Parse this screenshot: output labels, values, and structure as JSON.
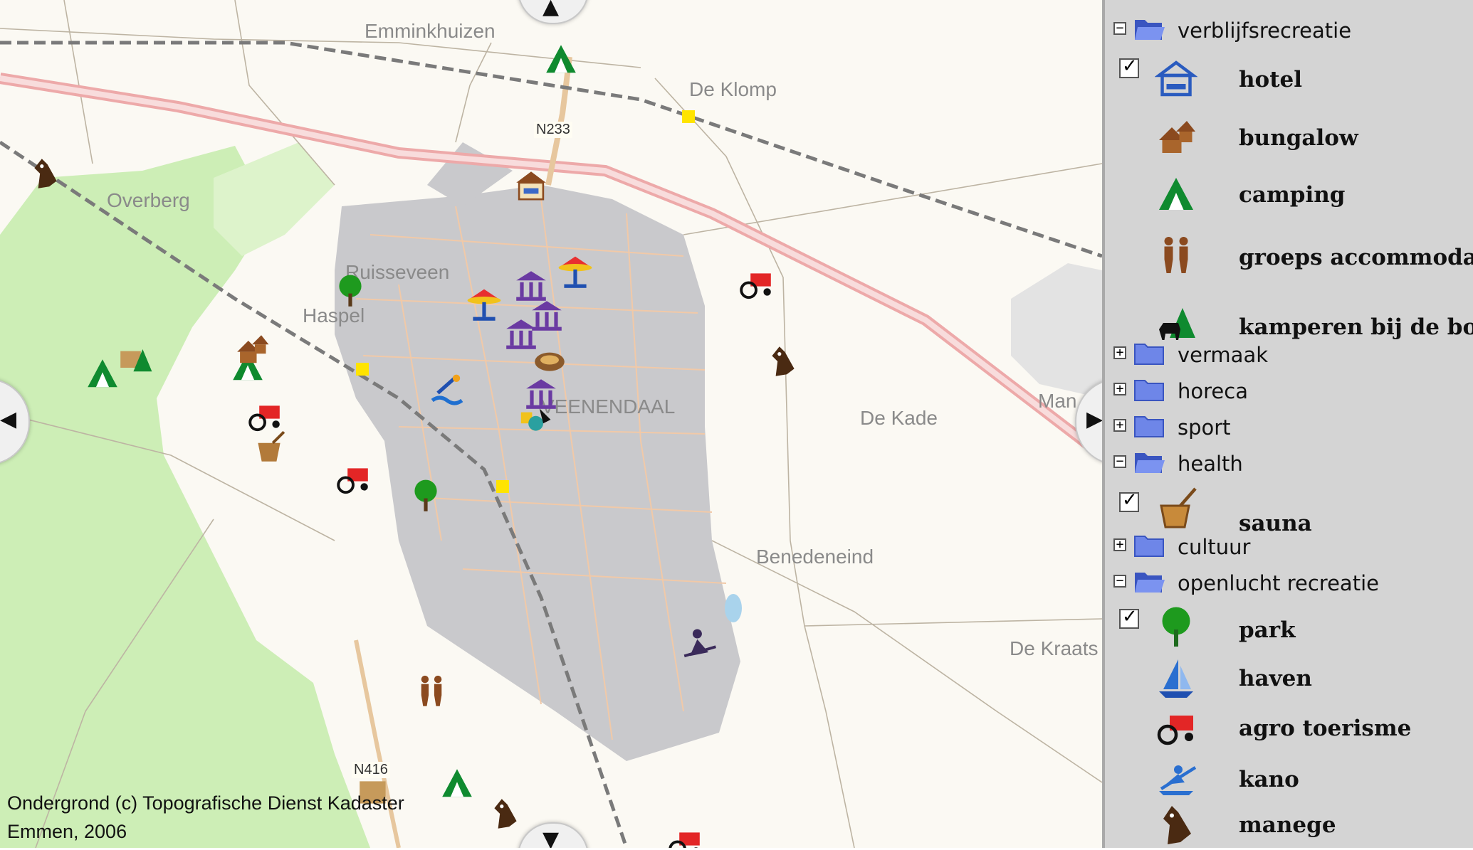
{
  "map": {
    "places": {
      "emminkhuizen": "Emminkhuizen",
      "de_klomp": "De Klomp",
      "overberg": "Overberg",
      "ruisseveen": "Ruisseveen",
      "haspel": "Haspel",
      "veenendaal": "VEENENDAAL",
      "de_kade": "De Kade",
      "man": "Man",
      "benedeneind": "Benedeneind",
      "de_kraats": "De Kraats"
    },
    "roads": {
      "n233": "N233",
      "n416": "N416"
    },
    "copyright_line1": "Ondergrond (c) Topografische Dienst Kadaster",
    "copyright_line2": "Emmen, 2006",
    "nav": {
      "up": "▲",
      "down": "▼",
      "left": "◀",
      "right": "▶"
    }
  },
  "legend": {
    "groups": {
      "verblijfsrecreatie": {
        "label": "verblijfsrecreatie",
        "expander": "−"
      },
      "vermaak": {
        "label": "vermaak",
        "expander": "+"
      },
      "horeca": {
        "label": "horeca",
        "expander": "+"
      },
      "sport": {
        "label": "sport",
        "expander": "+"
      },
      "health": {
        "label": "health",
        "expander": "−"
      },
      "cultuur": {
        "label": "cultuur",
        "expander": "+"
      },
      "openlucht": {
        "label": "openlucht recreatie",
        "expander": "−"
      }
    },
    "layers": {
      "hotel": "hotel",
      "bungalow": "bungalow",
      "camping": "camping",
      "groeps": "groeps accommodatie",
      "kamperen": "kamperen bij de boer",
      "sauna": "sauna",
      "park": "park",
      "haven": "haven",
      "agro": "agro toerisme",
      "kano": "kano",
      "manege": "manege"
    },
    "checkmark": "✓"
  },
  "colors": {
    "urban": "#c9c9cc",
    "green": "#cdeeb6",
    "road": "#eda9a9",
    "folder": "#6e86e8",
    "camping": "#0f8a2f",
    "agro": "#e32626",
    "manege": "#4a2a12"
  }
}
